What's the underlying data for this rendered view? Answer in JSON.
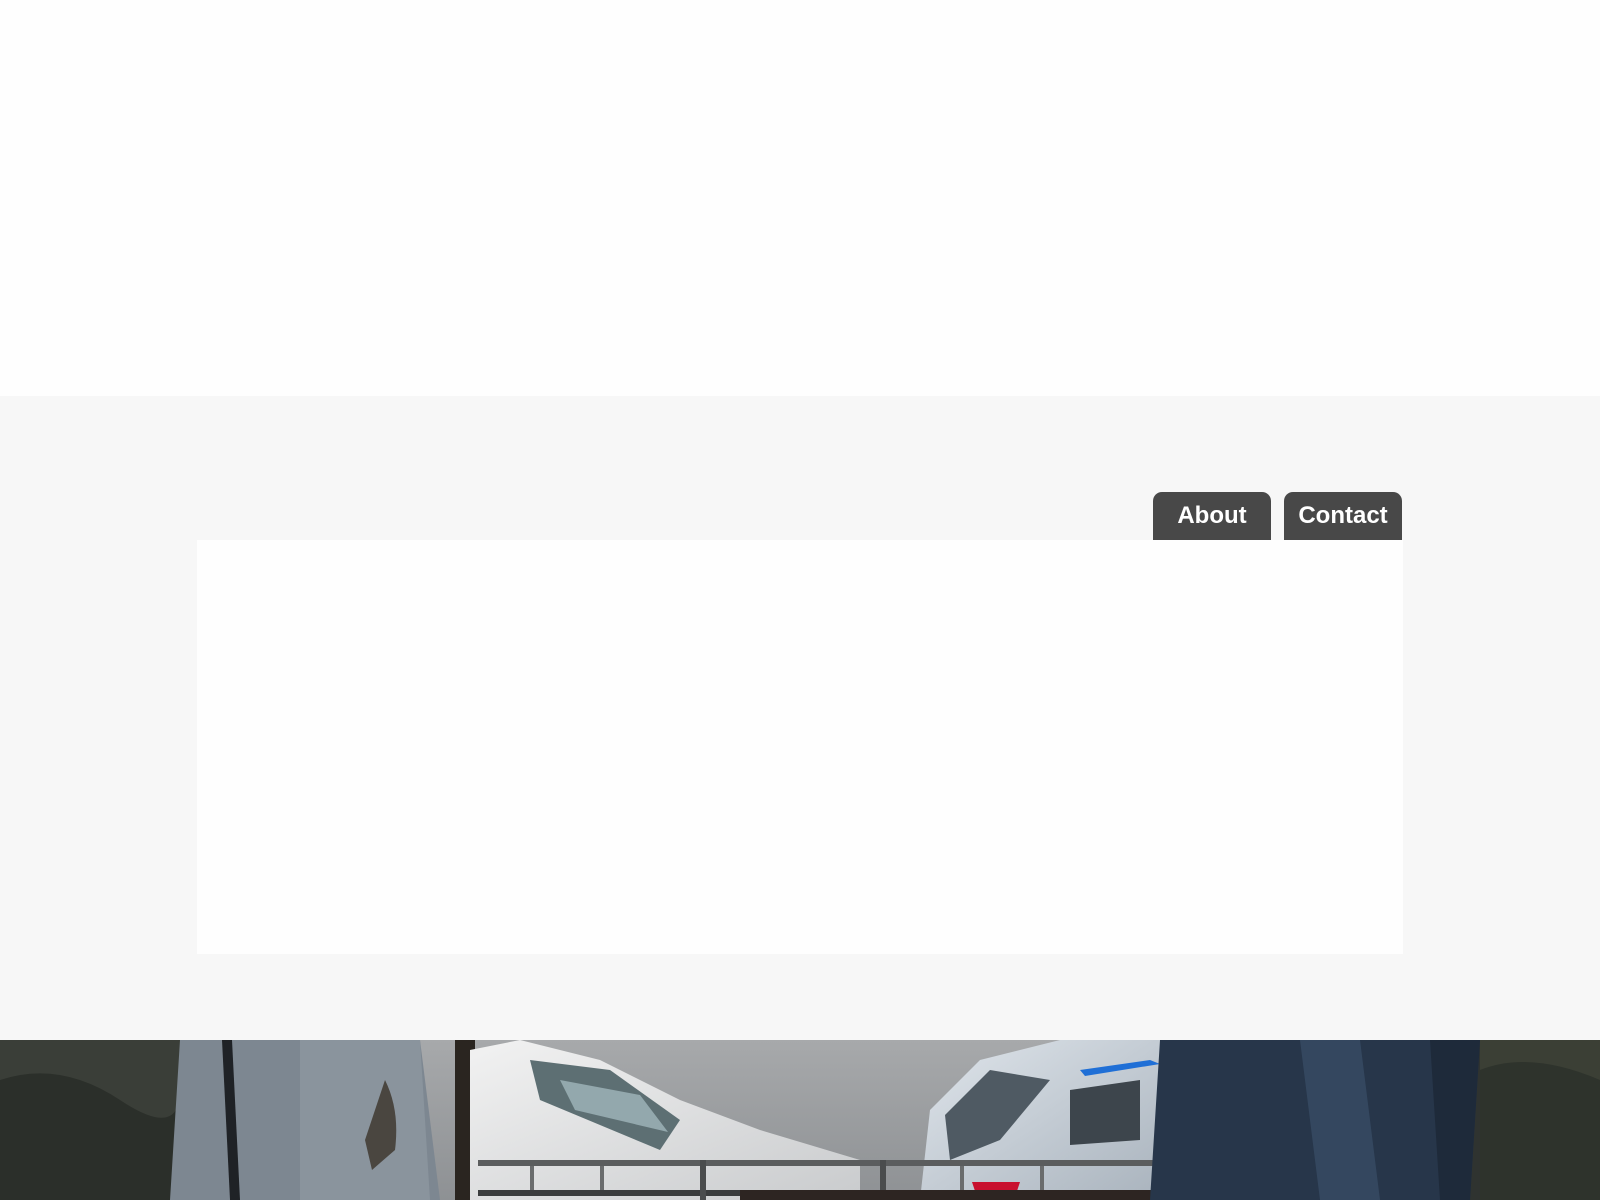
{
  "nav": {
    "tabs": [
      {
        "label": "About"
      },
      {
        "label": "Contact"
      }
    ]
  },
  "colors": {
    "header_background": "#fefefe",
    "page_background": "#f7f7f7",
    "content_panel": "#fefefe",
    "nav_tab": "#484848",
    "nav_text": "#ffffff"
  },
  "footer_image": {
    "icon": "street-photo-image"
  }
}
